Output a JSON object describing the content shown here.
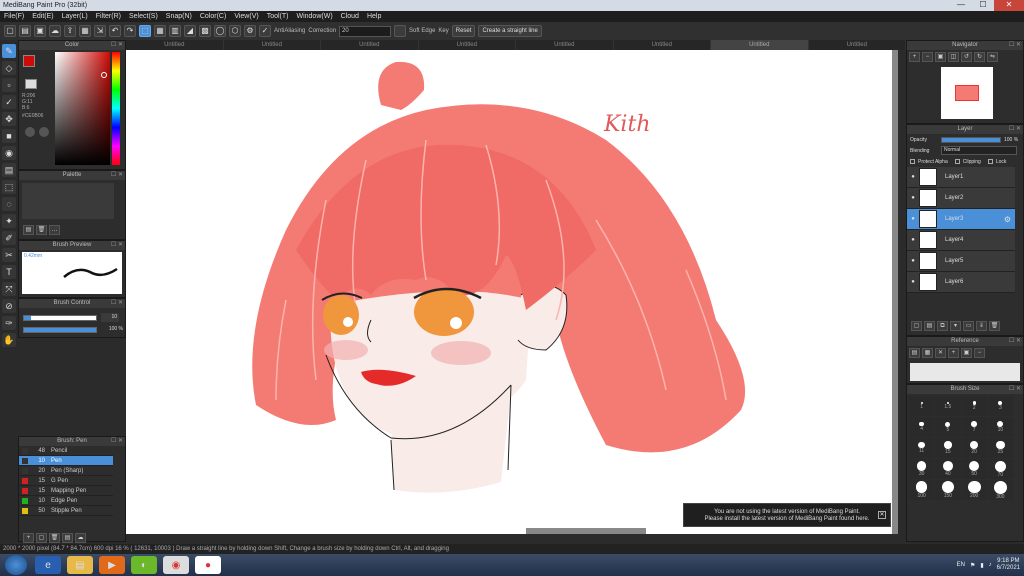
{
  "window": {
    "title": "MediBang Paint Pro (32bit)",
    "minimize": "—",
    "maximize": "☐",
    "close": "✕"
  },
  "menu": [
    "File(F)",
    "Edit(E)",
    "Layer(L)",
    "Filter(R)",
    "Select(S)",
    "Snap(N)",
    "Color(C)",
    "View(V)",
    "Tool(T)",
    "Window(W)",
    "Cloud",
    "Help"
  ],
  "toolbar": {
    "antialiasing": "AntiAliasing",
    "correction_label": "Correction",
    "correction_value": "20",
    "soft_edge": "Soft Edge",
    "key": "Key",
    "reset": "Reset",
    "straight_line": "Create a straight line"
  },
  "tabs": [
    "Untitled",
    "Untitled",
    "Untitled",
    "Untitled",
    "Untitled",
    "Untitled",
    "Untitled",
    "Untitled"
  ],
  "color_panel": {
    "title": "Color",
    "rgb": "R:206\nG:11\nB:6",
    "hex": "#CE0B06",
    "primary": "#ce0b06",
    "secondary": "#ffffff"
  },
  "palette": {
    "title": "Palette"
  },
  "brush_preview": {
    "title": "Brush Preview",
    "size": "0.42mm"
  },
  "brush_control": {
    "title": "Brush Control",
    "size_value": "10",
    "opacity_value": "100 %",
    "size_fraction": 0.1,
    "opacity_fraction": 1.0
  },
  "brush_list": {
    "title": "Brush: Pen",
    "items": [
      {
        "size": "48",
        "name": "Pencil",
        "color": "#333333"
      },
      {
        "size": "10",
        "name": "Pen",
        "color": "#333333"
      },
      {
        "size": "20",
        "name": "Pen (Sharp)",
        "color": "#333333"
      },
      {
        "size": "15",
        "name": "G Pen",
        "color": "#d42020"
      },
      {
        "size": "15",
        "name": "Mapping Pen",
        "color": "#d42020"
      },
      {
        "size": "10",
        "name": "Edge Pen",
        "color": "#20b020"
      },
      {
        "size": "50",
        "name": "Stipple Pen",
        "color": "#e0c010"
      }
    ]
  },
  "navigator": {
    "title": "Navigator"
  },
  "layer_panel": {
    "title": "Layer",
    "opacity_label": "Opacity",
    "opacity_value": "100 %",
    "opacity_fraction": 1.0,
    "blending_label": "Blending",
    "blending_value": "Normal",
    "protect_alpha": "Protect Alpha",
    "clipping": "Clipping",
    "lock": "Lock",
    "layers": [
      "Layer1",
      "Layer2",
      "Layer3",
      "Layer4",
      "Layer5",
      "Layer6"
    ],
    "selected_layer": "Layer3"
  },
  "reference": {
    "title": "Reference"
  },
  "brush_size": {
    "title": "Brush Size",
    "sizes": [
      "1",
      "1.5",
      "2",
      "3",
      "4",
      "5",
      "7",
      "10",
      "11",
      "15",
      "20",
      "25",
      "30",
      "40",
      "50",
      "70",
      "100",
      "150",
      "200",
      "300"
    ]
  },
  "canvas": {
    "signature": "Kith"
  },
  "notice": {
    "line1": "You are not using the latest version of MediBang Paint.",
    "line2": "Please install the latest version of MediBang Paint found here."
  },
  "status": "2000 * 2000 pixel  (84.7 * 84.7cm)  600 dpi  16 %  ( 12631, 10003 )  Draw a straight line by holding down Shift, Change a brush size by holding down Ctrl, Alt, and dragging",
  "taskbar": {
    "lang": "EN",
    "time": "9:18 PM",
    "date": "6/7/2021"
  }
}
